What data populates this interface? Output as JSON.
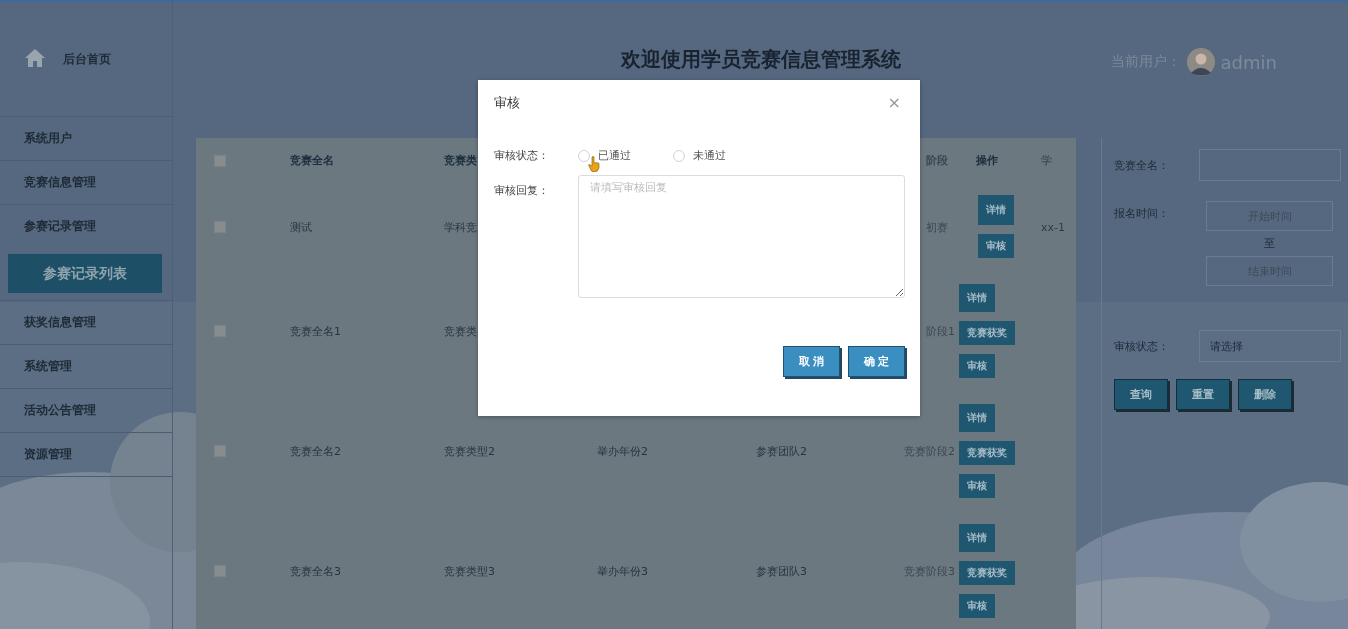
{
  "sidebar": {
    "home": {
      "label": "后台首页"
    },
    "items": [
      {
        "label": "系统用户",
        "expanded": false
      },
      {
        "label": "竞赛信息管理",
        "expanded": false
      },
      {
        "label": "参赛记录管理",
        "expanded": true,
        "children": [
          {
            "label": "参赛记录列表",
            "selected": true
          }
        ]
      },
      {
        "label": "获奖信息管理",
        "expanded": false
      },
      {
        "label": "系统管理",
        "expanded": false
      },
      {
        "label": "活动公告管理",
        "expanded": false
      },
      {
        "label": "资源管理",
        "expanded": false
      }
    ]
  },
  "header": {
    "title": "欢迎使用学员竞赛信息管理系统",
    "user_label": "当前用户：",
    "username": "admin"
  },
  "table": {
    "header": {
      "checked": false,
      "name": "竞赛全名",
      "type": "竞赛类",
      "stage": "阶段",
      "stage_partial": true,
      "actions": "操作",
      "column_8": "学"
    },
    "rows": [
      {
        "checked": false,
        "name": "测试",
        "type": "学科竞",
        "stage": "初赛",
        "stage_partial": true,
        "column_8": "xx-1",
        "actions": [
          "详情",
          "审核"
        ],
        "large_buttons": true
      },
      {
        "checked": false,
        "name": "竞赛全名1",
        "type": "竞赛类",
        "stage": "阶段1",
        "stage_partial": true,
        "actions": [
          "详情",
          "竞赛获奖",
          "审核"
        ],
        "large_buttons": false
      },
      {
        "checked": false,
        "name": "竞赛全名2",
        "type": "竞赛类型2",
        "year": "举办年份2",
        "team": "参赛团队2",
        "stage": "竞赛阶段2",
        "stage_partial": false,
        "actions": [
          "详情",
          "竞赛获奖",
          "审核"
        ],
        "large_buttons": false
      },
      {
        "checked": false,
        "name": "竞赛全名3",
        "type": "竞赛类型3",
        "year": "举办年份3",
        "team": "参赛团队3",
        "stage": "竞赛阶段3",
        "stage_partial": false,
        "actions": [
          "详情",
          "竞赛获奖",
          "审核"
        ],
        "large_buttons": false
      }
    ]
  },
  "filters": {
    "name": {
      "label": "竞赛全名："
    },
    "signup_time": {
      "label": "报名时间：",
      "start_placeholder": "开始时间",
      "separator": "至",
      "end_placeholder": "结束时间"
    },
    "status": {
      "label": "审核状态：",
      "placeholder": "请选择"
    },
    "buttons": [
      "查询",
      "重置",
      "删除"
    ]
  },
  "dialog": {
    "title": "审核",
    "close": "×",
    "status": {
      "label": "审核状态：",
      "options": [
        {
          "label": "已通过",
          "selected": false
        },
        {
          "label": "未通过",
          "selected": false
        }
      ]
    },
    "reply": {
      "label": "审核回复：",
      "placeholder": "请填写审核回复"
    },
    "buttons": [
      "取 消",
      "确 定"
    ]
  }
}
